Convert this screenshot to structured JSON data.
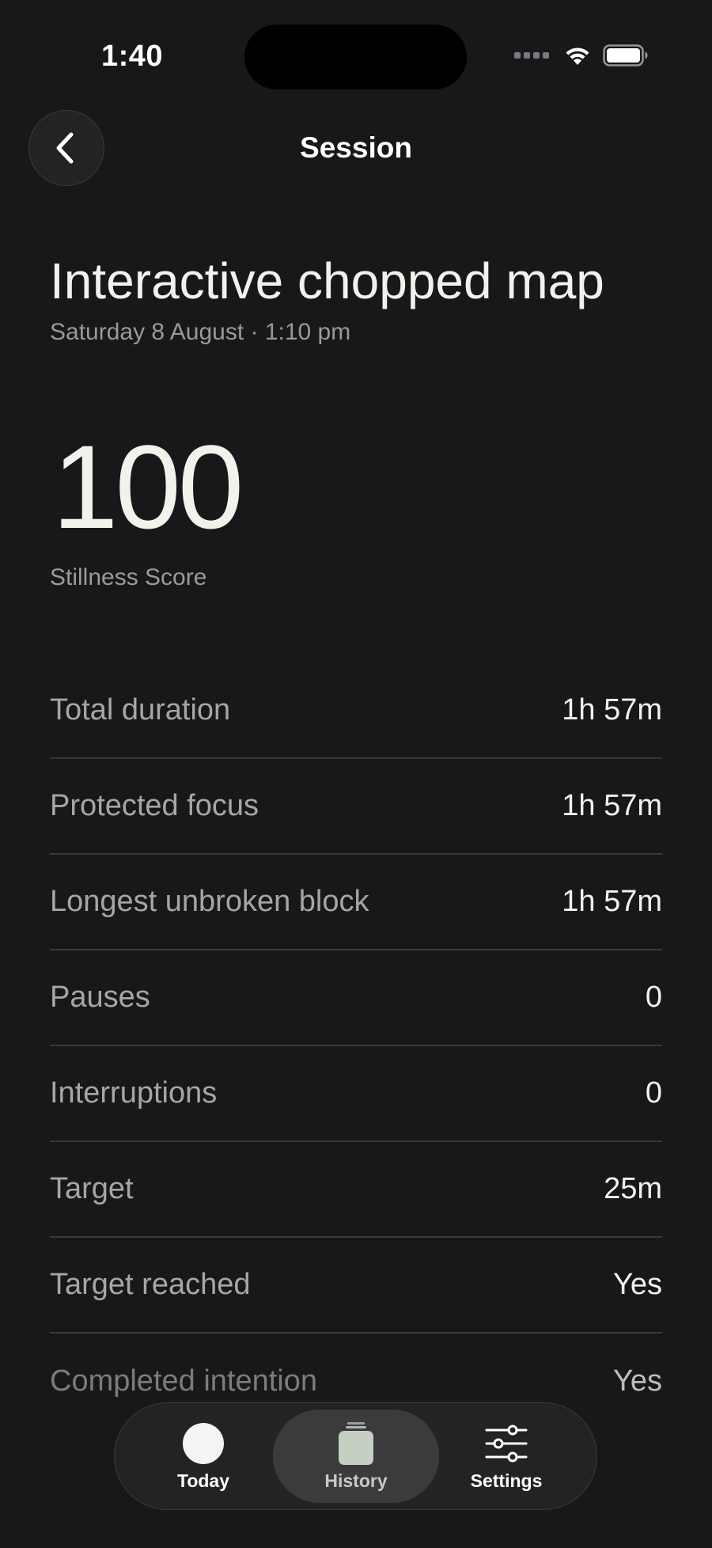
{
  "status_bar": {
    "time": "1:40"
  },
  "header": {
    "title": "Session",
    "back_icon": "chevron-left-icon"
  },
  "session": {
    "name": "Interactive chopped map",
    "date": "Saturday 8 August · 1:10 pm",
    "score": "100",
    "score_label": "Stillness Score"
  },
  "stats": [
    {
      "label": "Total duration",
      "value": "1h 57m"
    },
    {
      "label": "Protected focus",
      "value": "1h 57m"
    },
    {
      "label": "Longest unbroken block",
      "value": "1h 57m"
    },
    {
      "label": "Pauses",
      "value": "0"
    },
    {
      "label": "Interruptions",
      "value": "0"
    },
    {
      "label": "Target",
      "value": "25m"
    },
    {
      "label": "Target reached",
      "value": "Yes"
    },
    {
      "label": "Completed intention",
      "value": "Yes"
    }
  ],
  "tab_bar": {
    "today": {
      "label": "Today",
      "icon": "circle-icon"
    },
    "history": {
      "label": "History",
      "icon": "jar-icon",
      "selected": true
    },
    "settings": {
      "label": "Settings",
      "icon": "sliders-icon"
    }
  },
  "colors": {
    "background": "#18181a",
    "surface": "#232325",
    "text_primary": "#f2f1ec",
    "text_secondary": "#9a9a9c",
    "history_icon": "#c5cfc2"
  }
}
